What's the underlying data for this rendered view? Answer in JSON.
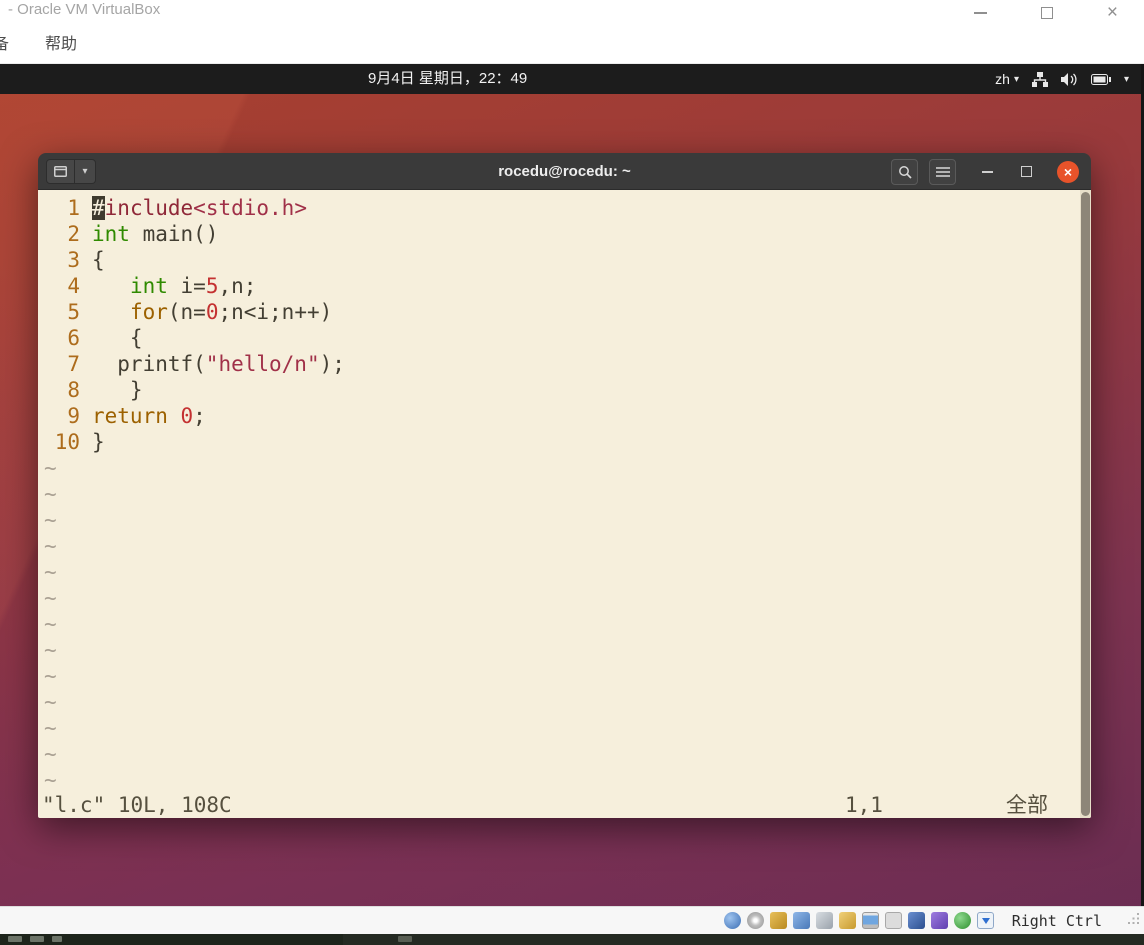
{
  "colors": {
    "terminal_close_button": "#e8532a",
    "vim_background": "#f6efdc",
    "topbar_background": "#1c1c1c",
    "wallpaper_top": "#a8402f",
    "wallpaper_bottom": "#6b2d52"
  },
  "vbox_window": {
    "title": "- Oracle VM VirtualBox",
    "controls": {
      "close": "×"
    },
    "menubar": {
      "items": [
        {
          "label": "备"
        },
        {
          "label": "帮助"
        }
      ]
    },
    "statusbar": {
      "host_key_label": "Right Ctrl",
      "icons": [
        "hdd",
        "optical-disc",
        "audio",
        "network",
        "usb",
        "shared-folders",
        "display",
        "recording",
        "features",
        "mouse",
        "globe",
        "keyboard-arrow"
      ]
    }
  },
  "ubuntu": {
    "topbar": {
      "clock": "9月4日 星期日，22：49",
      "language": "zh",
      "caret_glyph": "▾"
    }
  },
  "terminal": {
    "titlebar": {
      "title": "rocedu@rocedu: ~",
      "dropdown_glyph": "▾",
      "close_glyph": "×"
    }
  },
  "vim": {
    "lines": [
      {
        "n": "1",
        "seg": [
          {
            "c": "cursor",
            "t": "#"
          },
          {
            "c": "pp",
            "t": "include"
          },
          {
            "c": "str",
            "t": "<stdio.h>"
          }
        ]
      },
      {
        "n": "2",
        "seg": [
          {
            "c": "type",
            "t": "int"
          },
          {
            "c": "fg",
            "t": " main()"
          }
        ]
      },
      {
        "n": "3",
        "seg": [
          {
            "c": "fg",
            "t": "{"
          }
        ]
      },
      {
        "n": "4",
        "seg": [
          {
            "c": "fg",
            "t": "   "
          },
          {
            "c": "type",
            "t": "int"
          },
          {
            "c": "fg",
            "t": " i="
          },
          {
            "c": "num",
            "t": "5"
          },
          {
            "c": "fg",
            "t": ",n;"
          }
        ]
      },
      {
        "n": "5",
        "seg": [
          {
            "c": "fg",
            "t": "   "
          },
          {
            "c": "stmt",
            "t": "for"
          },
          {
            "c": "fg",
            "t": "(n="
          },
          {
            "c": "num",
            "t": "0"
          },
          {
            "c": "fg",
            "t": ";n<i;n++)"
          }
        ]
      },
      {
        "n": "6",
        "seg": [
          {
            "c": "fg",
            "t": "   {"
          }
        ]
      },
      {
        "n": "7",
        "seg": [
          {
            "c": "fg",
            "t": "  printf("
          },
          {
            "c": "str",
            "t": "\"hello/n\""
          },
          {
            "c": "fg",
            "t": ");"
          }
        ]
      },
      {
        "n": "8",
        "seg": [
          {
            "c": "fg",
            "t": "   }"
          }
        ]
      },
      {
        "n": "9",
        "seg": [
          {
            "c": "stmt",
            "t": "return"
          },
          {
            "c": "fg",
            "t": " "
          },
          {
            "c": "num",
            "t": "0"
          },
          {
            "c": "fg",
            "t": ";"
          }
        ]
      },
      {
        "n": "10",
        "seg": [
          {
            "c": "fg",
            "t": "}"
          }
        ]
      }
    ],
    "tilde_char": "~",
    "tilde_count": 13,
    "status": {
      "left": "\"l.c\" 10L, 108C",
      "position": "1,1",
      "scroll": "全部"
    }
  }
}
